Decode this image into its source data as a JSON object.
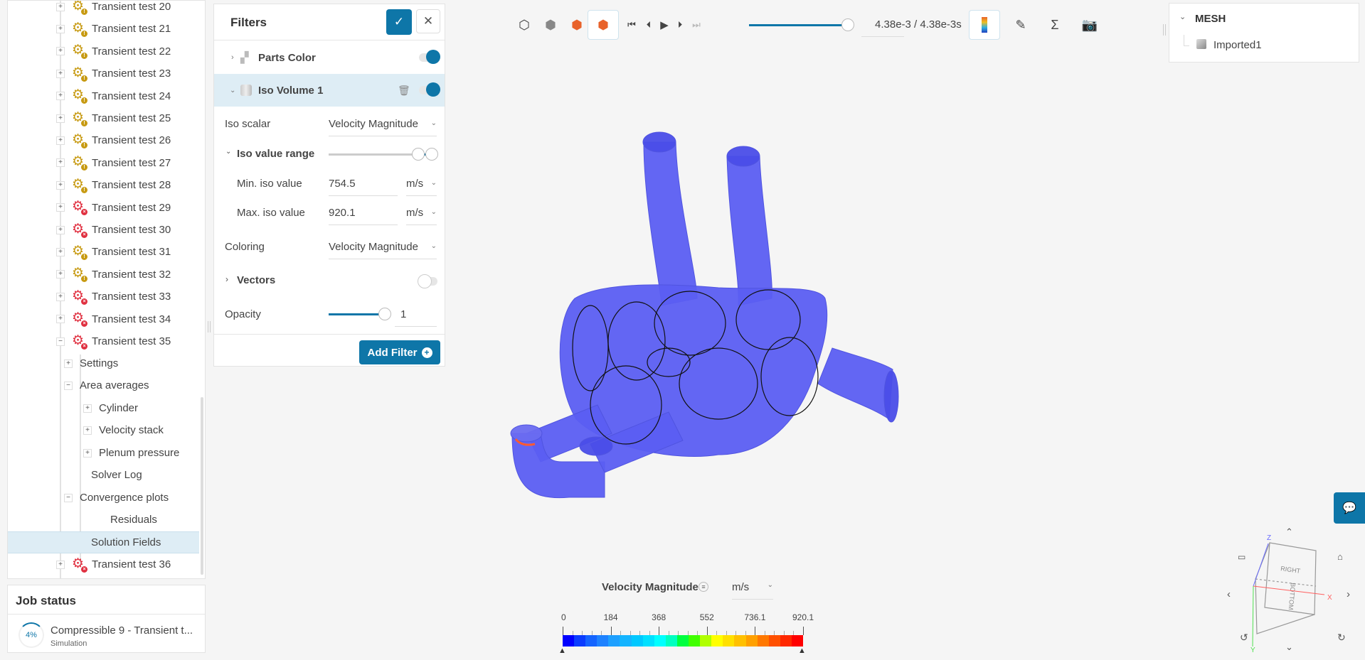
{
  "tree": {
    "tests": [
      {
        "label": "Transient test 20",
        "status": "warning"
      },
      {
        "label": "Transient test 21",
        "status": "warning"
      },
      {
        "label": "Transient test 22",
        "status": "warning"
      },
      {
        "label": "Transient test 23",
        "status": "warning"
      },
      {
        "label": "Transient test 24",
        "status": "warning"
      },
      {
        "label": "Transient test 25",
        "status": "warning"
      },
      {
        "label": "Transient test 26",
        "status": "warning"
      },
      {
        "label": "Transient test 27",
        "status": "warning"
      },
      {
        "label": "Transient test 28",
        "status": "warning"
      },
      {
        "label": "Transient test 29",
        "status": "error"
      },
      {
        "label": "Transient test 30",
        "status": "error"
      },
      {
        "label": "Transient test 31",
        "status": "warning"
      },
      {
        "label": "Transient test 32",
        "status": "warning"
      },
      {
        "label": "Transient test 33",
        "status": "error"
      },
      {
        "label": "Transient test 34",
        "status": "error"
      },
      {
        "label": "Transient test 35",
        "status": "error"
      }
    ],
    "children": {
      "settings": "Settings",
      "area_averages": "Area averages",
      "cylinder": "Cylinder",
      "velocity_stack": "Velocity stack",
      "plenum_pressure": "Plenum pressure",
      "solver_log": "Solver Log",
      "convergence_plots": "Convergence plots",
      "residuals": "Residuals",
      "solution_fields": "Solution Fields"
    },
    "last": {
      "label": "Transient test 36",
      "status": "error"
    },
    "status_colors": {
      "warning": "#c79a12",
      "error": "#e03040"
    }
  },
  "job": {
    "title": "Job status",
    "name": "Compressible 9 - Transient t...",
    "type": "Simulation",
    "progress": "4%"
  },
  "filters": {
    "title": "Filters",
    "parts_color": "Parts Color",
    "iso_volume": "Iso Volume 1",
    "iso_scalar_label": "Iso scalar",
    "iso_scalar": "Velocity Magnitude",
    "iso_range_label": "Iso value range",
    "min_label": "Min. iso value",
    "min_value": "754.5",
    "min_unit": "m/s",
    "max_label": "Max. iso value",
    "max_value": "920.1",
    "max_unit": "m/s",
    "coloring_label": "Coloring",
    "coloring": "Velocity Magnitude",
    "vectors_label": "Vectors",
    "vectors_on": false,
    "opacity_label": "Opacity",
    "opacity_value": "1",
    "add_filter": "Add Filter",
    "accent": "#0e76a8"
  },
  "toolbar": {
    "time": "4.38e-3 / 4.38e-3s",
    "time_progress": 1.0
  },
  "mesh": {
    "title": "MESH",
    "item": "Imported1"
  },
  "legend": {
    "title": "Velocity Magnitude",
    "unit": "m/s",
    "ticks": [
      "0",
      "184",
      "368",
      "552",
      "736.1",
      "920.1"
    ],
    "colors": [
      "#0000ff",
      "#0a3cff",
      "#1464ff",
      "#1e82ff",
      "#1ea0ff",
      "#14b4ff",
      "#00c8ff",
      "#00e0ff",
      "#00ffff",
      "#00ffc0",
      "#00ff40",
      "#40ff00",
      "#b0ff00",
      "#ffff00",
      "#ffe000",
      "#ffc000",
      "#ffa000",
      "#ff7800",
      "#ff5000",
      "#ff2800",
      "#ff0000"
    ]
  },
  "gizmo": {
    "right": "RIGHT",
    "bottom": "BOTTOM",
    "x": "X",
    "y": "Y",
    "z": "Z"
  }
}
